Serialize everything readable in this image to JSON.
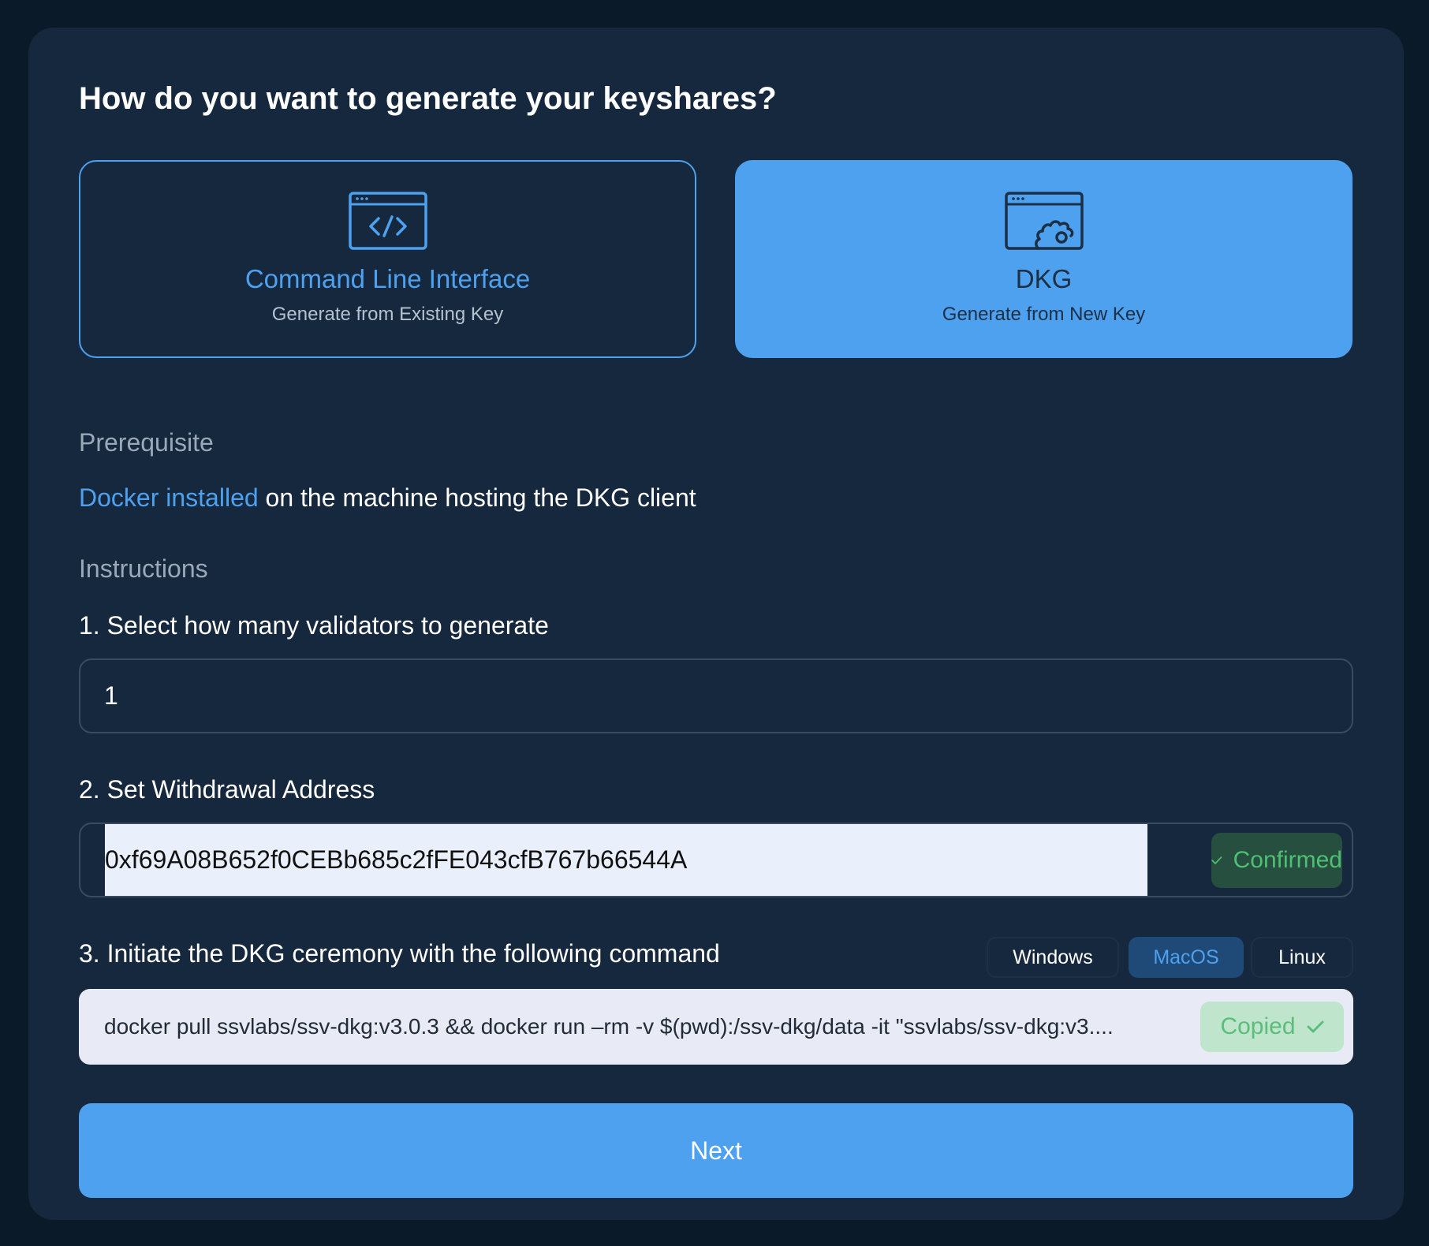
{
  "title": "How do you want to generate your keyshares?",
  "options": [
    {
      "title": "Command Line Interface",
      "subtitle": "Generate from Existing Key",
      "icon": "code-window-icon",
      "selected": false
    },
    {
      "title": "DKG",
      "subtitle": "Generate from New Key",
      "icon": "gear-window-icon",
      "selected": true
    }
  ],
  "prerequisite": {
    "label": "Prerequisite",
    "link_text": "Docker installed",
    "text": " on the machine hosting the DKG client"
  },
  "instructions": {
    "label": "Instructions",
    "step1": {
      "label": "1. Select how many validators to generate",
      "value": "1"
    },
    "step2": {
      "label": "2. Set Withdrawal Address",
      "value": "0xf69A08B652f0CEBb685c2fFE043cfB767b66544A",
      "status": "Confirmed"
    },
    "step3": {
      "label": "3. Initiate the DKG ceremony with the following command",
      "os_tabs": [
        "Windows",
        "MacOS",
        "Linux"
      ],
      "active_os": "MacOS",
      "command": "docker pull ssvlabs/ssv-dkg:v3.0.3 && docker run –rm -v $(pwd):/ssv-dkg/data -it \"ssvlabs/ssv-dkg:v3....",
      "copy_status": "Copied"
    }
  },
  "next_label": "Next",
  "colors": {
    "accent": "#4da1ef",
    "card_bg": "#15283d",
    "page_bg": "#0b1a28",
    "success": "#4fbf73"
  }
}
